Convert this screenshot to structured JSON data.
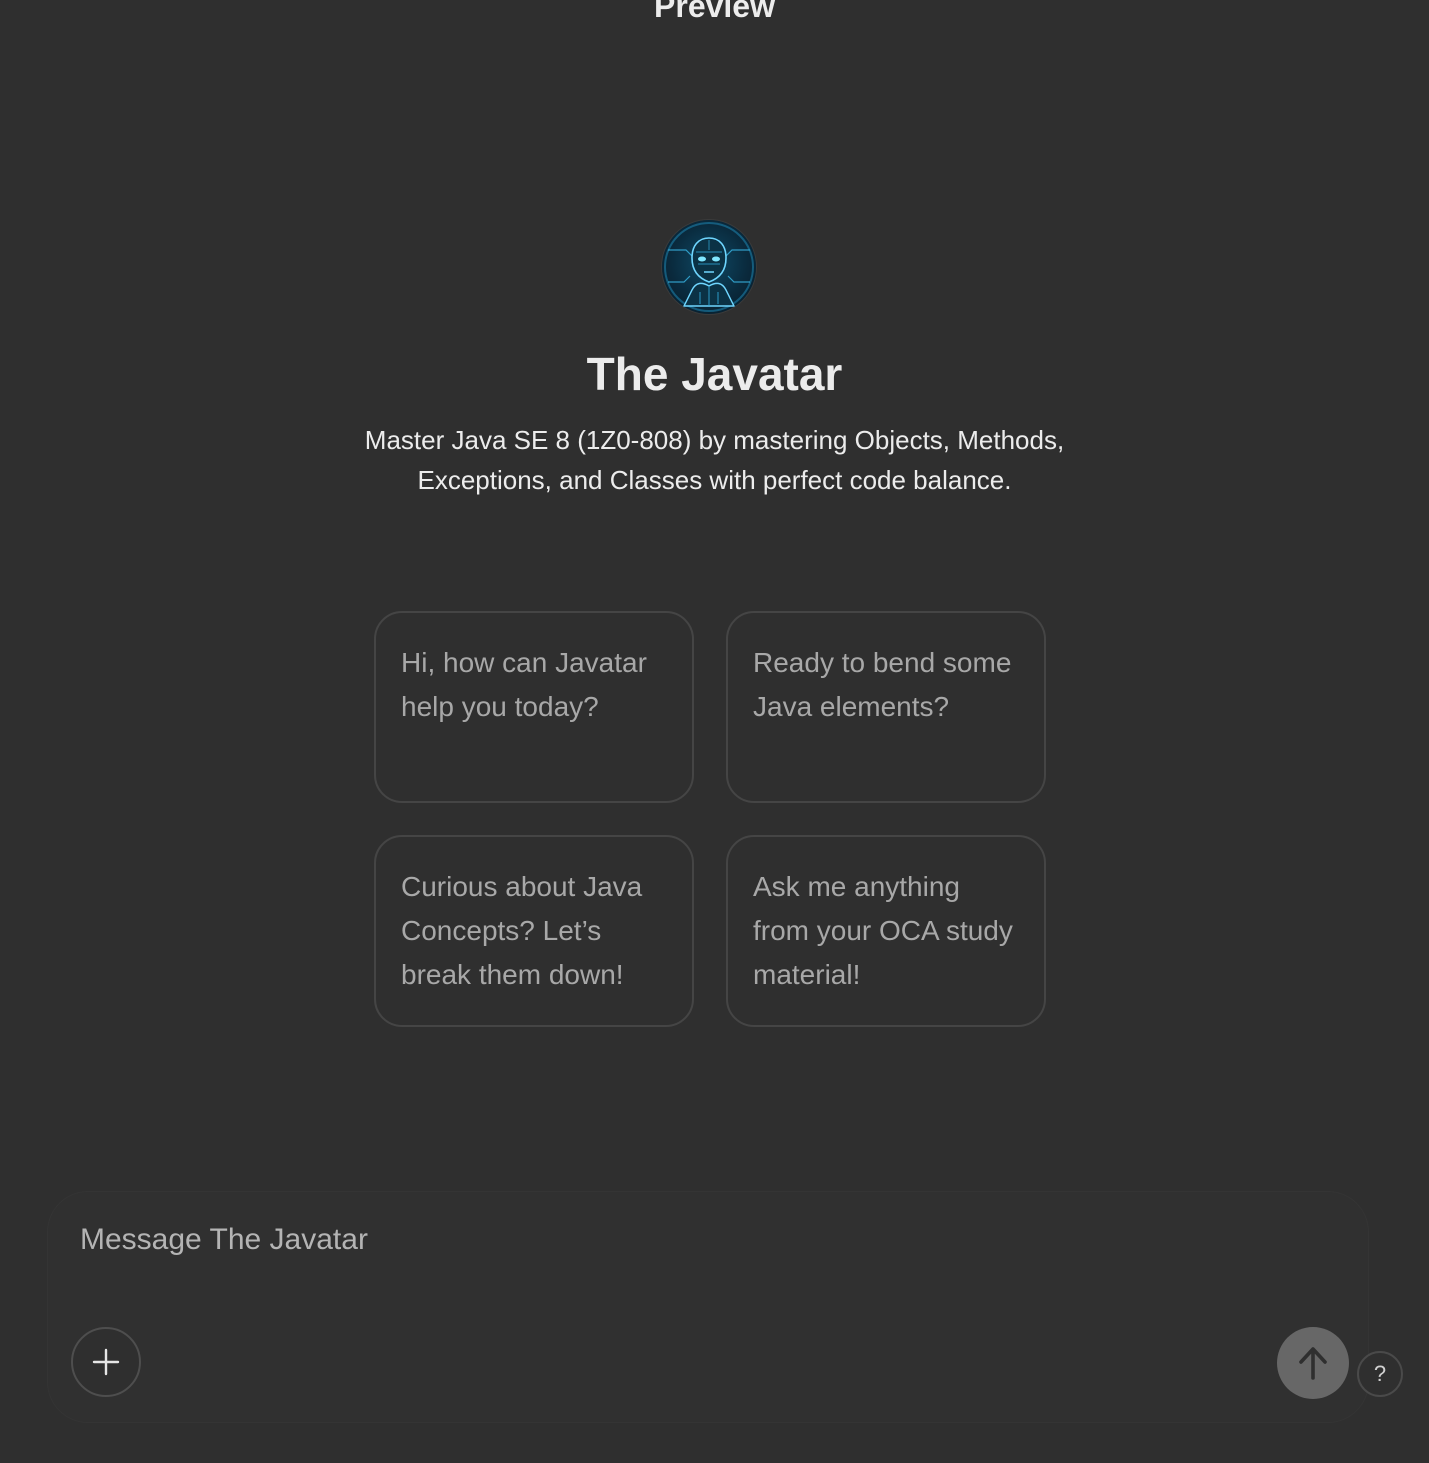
{
  "header": {
    "title": "Preview"
  },
  "gpt": {
    "name": "The Javatar",
    "description": "Master Java SE 8 (1Z0-808) by mastering Objects, Methods, Exceptions, and Classes with perfect code balance.",
    "avatar_icon": "robot-face-icon"
  },
  "starters": [
    {
      "label": "Hi, how can Javatar help you today?"
    },
    {
      "label": "Ready to bend some Java elements?"
    },
    {
      "label": "Curious about Java Concepts? Let’s break them down!"
    },
    {
      "label": "Ask me anything from your OCA study material!"
    }
  ],
  "composer": {
    "placeholder": "Message The Javatar",
    "attach_icon": "plus-icon",
    "send_icon": "arrow-up-icon",
    "help_label": "?"
  },
  "colors": {
    "background": "#2f2f2f",
    "text": "#ececec",
    "muted_text": "#a8a8a8",
    "card_border": "#454545",
    "send_button": "#676767"
  }
}
